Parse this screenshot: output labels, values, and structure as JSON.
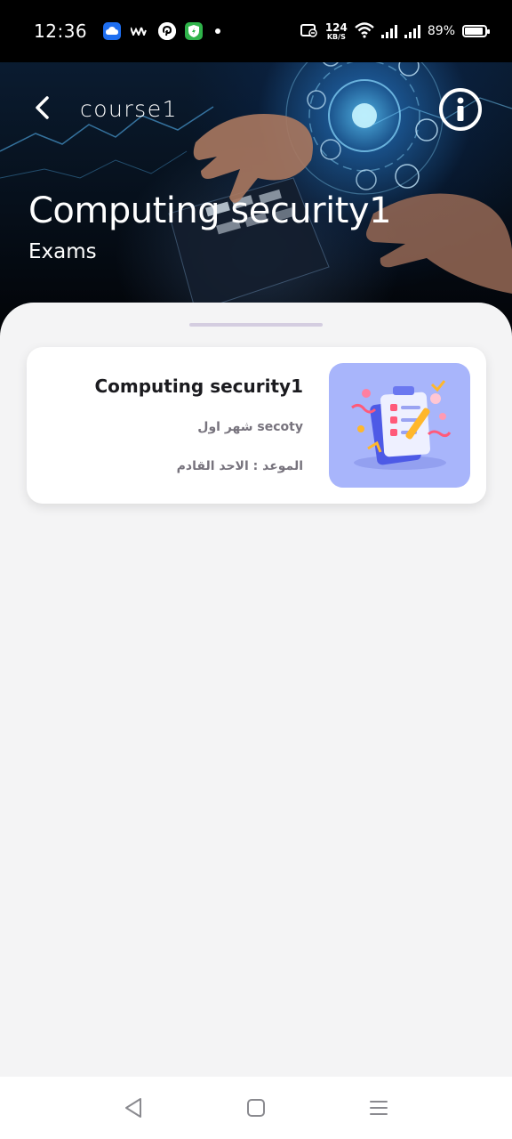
{
  "status_bar": {
    "time": "12:36",
    "speed_value": "124",
    "speed_unit": "KB/S",
    "battery": "89%",
    "battery_level": 0.89
  },
  "header": {
    "course_name": "course1",
    "title": "Computing security1",
    "subtitle": "Exams"
  },
  "exams": [
    {
      "title": "Computing security1",
      "subject": "secoty شهر اول",
      "date": "الموعد : الاحد القادم"
    }
  ],
  "icons": {
    "back": "chevron-left-icon",
    "info": "info-icon",
    "nav_back": "triangle-back-icon",
    "nav_home": "square-home-icon",
    "nav_menu": "menu-lines-icon"
  },
  "colors": {
    "sheet_bg": "#f4f4f5",
    "card_bg": "#ffffff",
    "thumb_bg": "#a8b5fb",
    "title_text": "#1b1b1f",
    "meta_text": "#77737d",
    "handle": "#d4cde0"
  }
}
